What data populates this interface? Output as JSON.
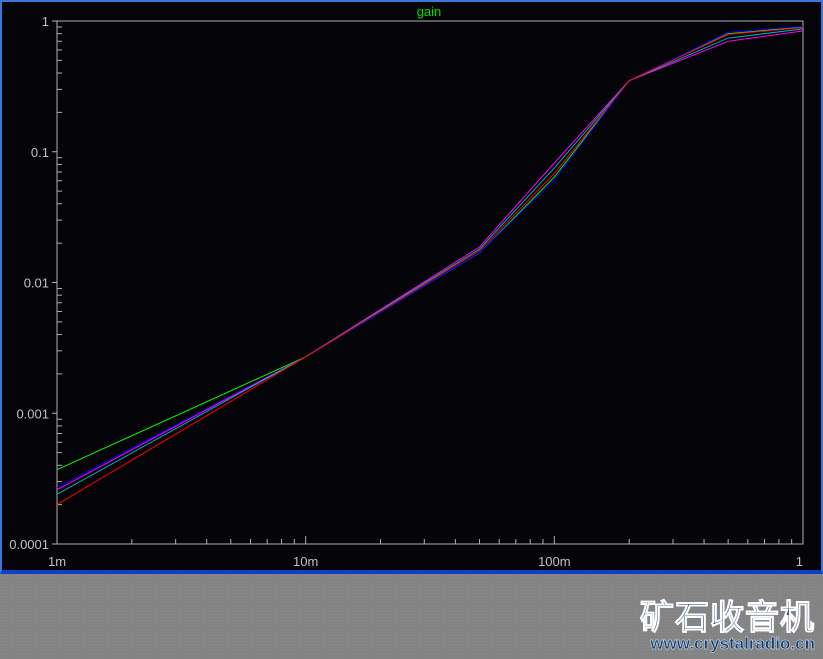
{
  "chart_data": {
    "type": "line",
    "title": "gain",
    "xlabel": "",
    "ylabel": "",
    "xscale": "log",
    "yscale": "log",
    "xlim": [
      0.001,
      1
    ],
    "ylim": [
      0.0001,
      1
    ],
    "x_ticks": [
      {
        "v": 0.001,
        "label": "1m"
      },
      {
        "v": 0.01,
        "label": "10m"
      },
      {
        "v": 0.1,
        "label": "100m"
      },
      {
        "v": 1,
        "label": "1"
      }
    ],
    "y_ticks": [
      {
        "v": 1,
        "label": "1"
      },
      {
        "v": 0.1,
        "label": "0.1"
      },
      {
        "v": 0.01,
        "label": "0.01"
      },
      {
        "v": 0.001,
        "label": "0.001"
      },
      {
        "v": 0.0001,
        "label": "0.0001"
      }
    ],
    "x": [
      0.001,
      0.01,
      0.05,
      0.1,
      0.2,
      0.5,
      1
    ],
    "series": [
      {
        "name": "green",
        "color": "#00ff00",
        "values": [
          0.00037,
          0.0027,
          0.0168,
          0.064,
          0.35,
          0.8,
          0.9
        ]
      },
      {
        "name": "blue",
        "color": "#0000ff",
        "values": [
          0.00027,
          0.0027,
          0.0168,
          0.061,
          0.35,
          0.82,
          0.91
        ]
      },
      {
        "name": "magenta",
        "color": "#ff00ff",
        "values": [
          0.00026,
          0.0027,
          0.0187,
          0.082,
          0.35,
          0.7,
          0.84
        ]
      },
      {
        "name": "cyan",
        "color": "#00b0b0",
        "values": [
          0.00024,
          0.0027,
          0.018,
          0.075,
          0.35,
          0.74,
          0.87
        ]
      },
      {
        "name": "red",
        "color": "#ff0000",
        "values": [
          0.0002,
          0.0027,
          0.0175,
          0.068,
          0.35,
          0.79,
          0.89
        ]
      }
    ]
  },
  "watermark": {
    "title": "矿石收音机",
    "url": "www.crystalradio.cn"
  }
}
